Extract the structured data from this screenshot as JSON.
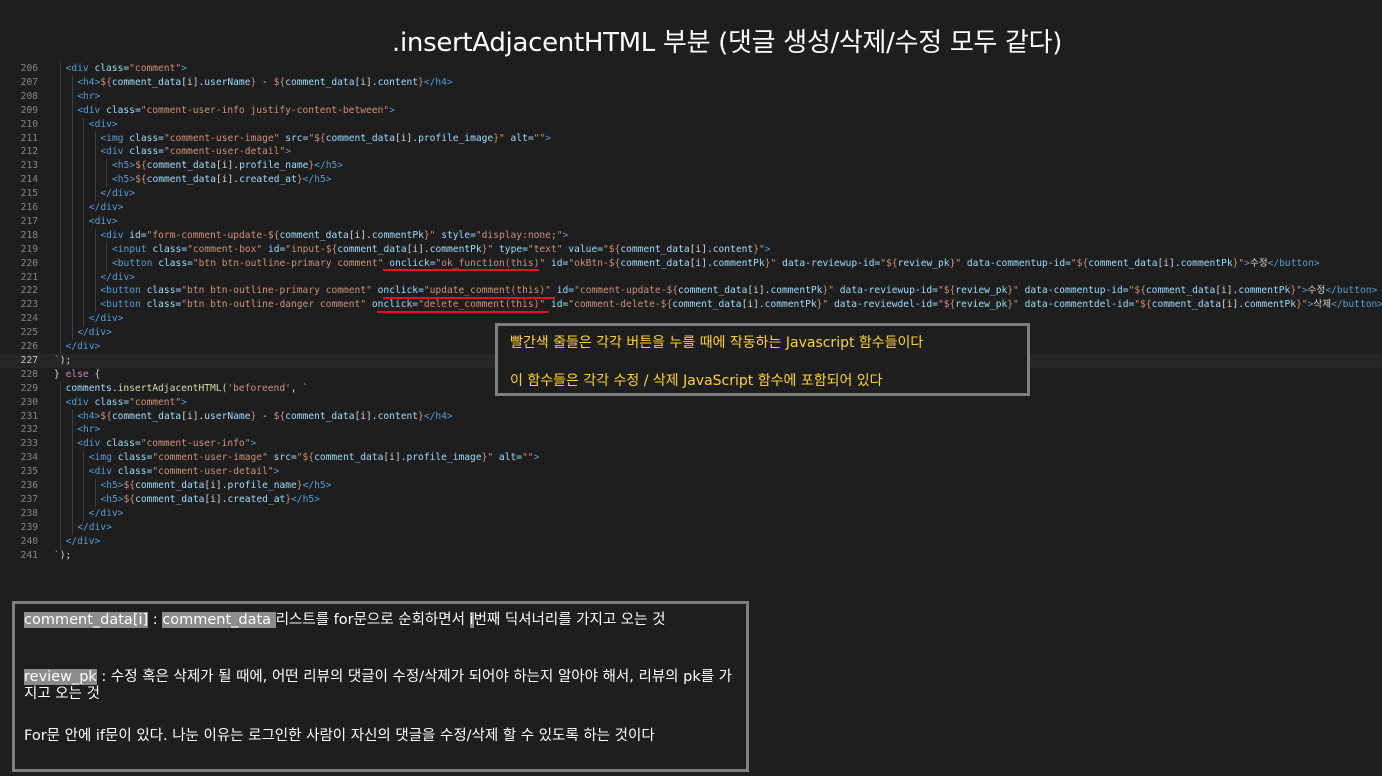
{
  "title": ".insertAdjacentHTML 부분 (댓글 생성/삭제/수정 모두 같다)",
  "code": {
    "lines": [
      {
        "n": "206",
        "indent": 1,
        "tokens": [
          [
            "tag",
            "<div "
          ],
          [
            "attr",
            "class="
          ],
          [
            "str",
            "\"comment\""
          ],
          [
            "tag",
            ">"
          ]
        ]
      },
      {
        "n": "207",
        "indent": 2,
        "tokens": [
          [
            "tag",
            "<h4>"
          ],
          [
            "str",
            "${"
          ],
          [
            "var",
            "comment_data"
          ],
          [
            "txt",
            "[i]."
          ],
          [
            "var",
            "userName"
          ],
          [
            "str",
            "}"
          ],
          [
            "txt",
            " - "
          ],
          [
            "str",
            "${"
          ],
          [
            "var",
            "comment_data"
          ],
          [
            "txt",
            "[i]."
          ],
          [
            "var",
            "content"
          ],
          [
            "str",
            "}"
          ],
          [
            "tag",
            "</h4>"
          ]
        ]
      },
      {
        "n": "208",
        "indent": 2,
        "tokens": [
          [
            "tag",
            "<hr>"
          ]
        ]
      },
      {
        "n": "209",
        "indent": 2,
        "tokens": [
          [
            "tag",
            "<div "
          ],
          [
            "attr",
            "class="
          ],
          [
            "str",
            "\"comment-user-info justify-content-between\""
          ],
          [
            "tag",
            ">"
          ]
        ]
      },
      {
        "n": "210",
        "indent": 3,
        "tokens": [
          [
            "tag",
            "<div>"
          ]
        ]
      },
      {
        "n": "211",
        "indent": 4,
        "tokens": [
          [
            "tag",
            "<img "
          ],
          [
            "attr",
            "class="
          ],
          [
            "str",
            "\"comment-user-image\" "
          ],
          [
            "attr",
            "src="
          ],
          [
            "str",
            "\"${"
          ],
          [
            "var",
            "comment_data"
          ],
          [
            "txt",
            "[i]."
          ],
          [
            "var",
            "profile_image"
          ],
          [
            "str",
            "}\" "
          ],
          [
            "attr",
            "alt="
          ],
          [
            "str",
            "\"\""
          ],
          [
            "tag",
            ">"
          ]
        ]
      },
      {
        "n": "212",
        "indent": 4,
        "tokens": [
          [
            "tag",
            "<div "
          ],
          [
            "attr",
            "class="
          ],
          [
            "str",
            "\"comment-user-detail\""
          ],
          [
            "tag",
            ">"
          ]
        ]
      },
      {
        "n": "213",
        "indent": 5,
        "tokens": [
          [
            "tag",
            "<h5>"
          ],
          [
            "str",
            "${"
          ],
          [
            "var",
            "comment_data"
          ],
          [
            "txt",
            "[i]."
          ],
          [
            "var",
            "profile_name"
          ],
          [
            "str",
            "}"
          ],
          [
            "tag",
            "</h5>"
          ]
        ]
      },
      {
        "n": "214",
        "indent": 5,
        "tokens": [
          [
            "tag",
            "<h5>"
          ],
          [
            "str",
            "${"
          ],
          [
            "var",
            "comment_data"
          ],
          [
            "txt",
            "[i]."
          ],
          [
            "var",
            "created_at"
          ],
          [
            "str",
            "}"
          ],
          [
            "tag",
            "</h5>"
          ]
        ]
      },
      {
        "n": "215",
        "indent": 4,
        "tokens": [
          [
            "tag",
            "</div>"
          ]
        ]
      },
      {
        "n": "216",
        "indent": 3,
        "tokens": [
          [
            "tag",
            "</div>"
          ]
        ]
      },
      {
        "n": "217",
        "indent": 3,
        "tokens": [
          [
            "tag",
            "<div>"
          ]
        ]
      },
      {
        "n": "218",
        "indent": 4,
        "tokens": [
          [
            "tag",
            "<div "
          ],
          [
            "attr",
            "id="
          ],
          [
            "str",
            "\"form-comment-update-${"
          ],
          [
            "var",
            "comment_data"
          ],
          [
            "txt",
            "[i]."
          ],
          [
            "var",
            "commentPk"
          ],
          [
            "str",
            "}\" "
          ],
          [
            "attr",
            "style="
          ],
          [
            "str",
            "\"display:none;\""
          ],
          [
            "tag",
            ">"
          ]
        ]
      },
      {
        "n": "219",
        "indent": 5,
        "tokens": [
          [
            "tag",
            "<input "
          ],
          [
            "attr",
            "class="
          ],
          [
            "str",
            "\"comment-box\" "
          ],
          [
            "attr",
            "id="
          ],
          [
            "str",
            "\"input-${"
          ],
          [
            "var",
            "comment_data"
          ],
          [
            "txt",
            "[i]."
          ],
          [
            "var",
            "commentPk"
          ],
          [
            "str",
            "}\" "
          ],
          [
            "attr",
            "type="
          ],
          [
            "str",
            "\"text\" "
          ],
          [
            "attr",
            "value="
          ],
          [
            "str",
            "\"${"
          ],
          [
            "var",
            "comment_data"
          ],
          [
            "txt",
            "[i]."
          ],
          [
            "var",
            "content"
          ],
          [
            "str",
            "}\""
          ],
          [
            "tag",
            ">"
          ]
        ]
      },
      {
        "n": "220",
        "indent": 5,
        "tokens": [
          [
            "tag",
            "<button "
          ],
          [
            "attr",
            "class="
          ],
          [
            "str",
            "\"btn btn-outline-primary comment\" "
          ],
          [
            "attr",
            "onclick="
          ],
          [
            "str",
            "\"ok_function(this)\" "
          ],
          [
            "attr",
            "id="
          ],
          [
            "str",
            "\"okBtn-${"
          ],
          [
            "var",
            "comment_data"
          ],
          [
            "txt",
            "[i]."
          ],
          [
            "var",
            "commentPk"
          ],
          [
            "str",
            "}\" "
          ],
          [
            "attr",
            "data-reviewup-id="
          ],
          [
            "str",
            "\"${"
          ],
          [
            "var",
            "review_pk"
          ],
          [
            "str",
            "}\" "
          ],
          [
            "attr",
            "data-commentup-id="
          ],
          [
            "str",
            "\"${"
          ],
          [
            "var",
            "comment_data"
          ],
          [
            "txt",
            "[i]."
          ],
          [
            "var",
            "commentPk"
          ],
          [
            "str",
            "}\""
          ],
          [
            "tag",
            ">"
          ],
          [
            "txt",
            "수정"
          ],
          [
            "tag",
            "</button>"
          ]
        ]
      },
      {
        "n": "221",
        "indent": 4,
        "tokens": [
          [
            "tag",
            "</div>"
          ]
        ]
      },
      {
        "n": "222",
        "indent": 4,
        "tokens": [
          [
            "tag",
            "<button "
          ],
          [
            "attr",
            "class="
          ],
          [
            "str",
            "\"btn btn-outline-primary comment\" "
          ],
          [
            "attr",
            "onclick="
          ],
          [
            "str",
            "\"update_comment(this)\" "
          ],
          [
            "attr",
            "id="
          ],
          [
            "str",
            "\"comment-update-${"
          ],
          [
            "var",
            "comment_data"
          ],
          [
            "txt",
            "[i]."
          ],
          [
            "var",
            "commentPk"
          ],
          [
            "str",
            "}\" "
          ],
          [
            "attr",
            "data-reviewup-id="
          ],
          [
            "str",
            "\"${"
          ],
          [
            "var",
            "review_pk"
          ],
          [
            "str",
            "}\" "
          ],
          [
            "attr",
            "data-commentup-id="
          ],
          [
            "str",
            "\"${"
          ],
          [
            "var",
            "comment_data"
          ],
          [
            "txt",
            "[i]."
          ],
          [
            "var",
            "commentPk"
          ],
          [
            "str",
            "}\""
          ],
          [
            "tag",
            ">"
          ],
          [
            "txt",
            "수정"
          ],
          [
            "tag",
            "</button>"
          ]
        ]
      },
      {
        "n": "223",
        "indent": 4,
        "tokens": [
          [
            "tag",
            "<button "
          ],
          [
            "attr",
            "class="
          ],
          [
            "str",
            "\"btn btn-outline-danger comment\" "
          ],
          [
            "attr",
            "onclick="
          ],
          [
            "str",
            "\"delete_comment(this)\" "
          ],
          [
            "attr",
            "id="
          ],
          [
            "str",
            "\"comment-delete-${"
          ],
          [
            "var",
            "comment_data"
          ],
          [
            "txt",
            "[i]."
          ],
          [
            "var",
            "commentPk"
          ],
          [
            "str",
            "}\" "
          ],
          [
            "attr",
            "data-reviewdel-id="
          ],
          [
            "str",
            "\"${"
          ],
          [
            "var",
            "review_pk"
          ],
          [
            "str",
            "}\" "
          ],
          [
            "attr",
            "data-commentdel-id="
          ],
          [
            "str",
            "\"${"
          ],
          [
            "var",
            "comment_data"
          ],
          [
            "txt",
            "[i]."
          ],
          [
            "var",
            "commentPk"
          ],
          [
            "str",
            "}\""
          ],
          [
            "tag",
            ">"
          ],
          [
            "txt",
            "삭제"
          ],
          [
            "tag",
            "</button>"
          ]
        ]
      },
      {
        "n": "224",
        "indent": 3,
        "tokens": [
          [
            "tag",
            "</div>"
          ]
        ]
      },
      {
        "n": "225",
        "indent": 2,
        "tokens": [
          [
            "tag",
            "</div>"
          ]
        ]
      },
      {
        "n": "226",
        "indent": 1,
        "tokens": [
          [
            "tag",
            "</div>"
          ]
        ]
      },
      {
        "n": "227",
        "indent": 0,
        "current": true,
        "tokens": [
          [
            "str",
            "`"
          ],
          [
            "txt",
            ");"
          ]
        ]
      },
      {
        "n": "228",
        "indent": 0,
        "tokens": [
          [
            "txt",
            "} "
          ],
          [
            "kw",
            "else"
          ],
          [
            "txt",
            " {"
          ]
        ]
      },
      {
        "n": "229",
        "indent": 1,
        "tokens": [
          [
            "var",
            "comments"
          ],
          [
            "txt",
            "."
          ],
          [
            "fn",
            "insertAdjacentHTML"
          ],
          [
            "txt",
            "("
          ],
          [
            "str",
            "'beforeend'"
          ],
          [
            "txt",
            ", "
          ],
          [
            "str",
            "`"
          ]
        ]
      },
      {
        "n": "230",
        "indent": 1,
        "tokens": [
          [
            "tag",
            "<div "
          ],
          [
            "attr",
            "class="
          ],
          [
            "str",
            "\"comment\""
          ],
          [
            "tag",
            ">"
          ]
        ]
      },
      {
        "n": "231",
        "indent": 2,
        "tokens": [
          [
            "tag",
            "<h4>"
          ],
          [
            "str",
            "${"
          ],
          [
            "var",
            "comment_data"
          ],
          [
            "txt",
            "[i]."
          ],
          [
            "var",
            "userName"
          ],
          [
            "str",
            "}"
          ],
          [
            "txt",
            " - "
          ],
          [
            "str",
            "${"
          ],
          [
            "var",
            "comment_data"
          ],
          [
            "txt",
            "[i]."
          ],
          [
            "var",
            "content"
          ],
          [
            "str",
            "}"
          ],
          [
            "tag",
            "</h4>"
          ]
        ]
      },
      {
        "n": "232",
        "indent": 2,
        "tokens": [
          [
            "tag",
            "<hr>"
          ]
        ]
      },
      {
        "n": "233",
        "indent": 2,
        "tokens": [
          [
            "tag",
            "<div "
          ],
          [
            "attr",
            "class="
          ],
          [
            "str",
            "\"comment-user-info\""
          ],
          [
            "tag",
            ">"
          ]
        ]
      },
      {
        "n": "234",
        "indent": 3,
        "tokens": [
          [
            "tag",
            "<img "
          ],
          [
            "attr",
            "class="
          ],
          [
            "str",
            "\"comment-user-image\" "
          ],
          [
            "attr",
            "src="
          ],
          [
            "str",
            "\"${"
          ],
          [
            "var",
            "comment_data"
          ],
          [
            "txt",
            "[i]."
          ],
          [
            "var",
            "profile_image"
          ],
          [
            "str",
            "}\" "
          ],
          [
            "attr",
            "alt="
          ],
          [
            "str",
            "\"\""
          ],
          [
            "tag",
            ">"
          ]
        ]
      },
      {
        "n": "235",
        "indent": 3,
        "tokens": [
          [
            "tag",
            "<div "
          ],
          [
            "attr",
            "class="
          ],
          [
            "str",
            "\"comment-user-detail\""
          ],
          [
            "tag",
            ">"
          ]
        ]
      },
      {
        "n": "236",
        "indent": 4,
        "tokens": [
          [
            "tag",
            "<h5>"
          ],
          [
            "str",
            "${"
          ],
          [
            "var",
            "comment_data"
          ],
          [
            "txt",
            "[i]."
          ],
          [
            "var",
            "profile_name"
          ],
          [
            "str",
            "}"
          ],
          [
            "tag",
            "</h5>"
          ]
        ]
      },
      {
        "n": "237",
        "indent": 4,
        "tokens": [
          [
            "tag",
            "<h5>"
          ],
          [
            "str",
            "${"
          ],
          [
            "var",
            "comment_data"
          ],
          [
            "txt",
            "[i]."
          ],
          [
            "var",
            "created_at"
          ],
          [
            "str",
            "}"
          ],
          [
            "tag",
            "</h5>"
          ]
        ]
      },
      {
        "n": "238",
        "indent": 3,
        "tokens": [
          [
            "tag",
            "</div>"
          ]
        ]
      },
      {
        "n": "239",
        "indent": 2,
        "tokens": [
          [
            "tag",
            "</div>"
          ]
        ]
      },
      {
        "n": "240",
        "indent": 1,
        "tokens": [
          [
            "tag",
            "</div>"
          ]
        ]
      },
      {
        "n": "241",
        "indent": 0,
        "tokens": [
          [
            "str",
            "`"
          ],
          [
            "txt",
            ");"
          ]
        ]
      }
    ]
  },
  "note_top": {
    "line1": "빨간색 줄들은 각각 버튼을 누를 때에 작동하는 Javascript 함수들이다",
    "line2": "이 함수들은 각각 수정 / 삭제 JavaScript 함수에 포함되어 있다"
  },
  "note_bottom": {
    "p1_hl1": "comment_data[i]",
    "p1_sep": " : ",
    "p1_hl2": "comment_data ",
    "p1_rest_a": "리스트를 for문으로 순회하면서 ",
    "p1_hl3": "i",
    "p1_rest_b": "번째 딕셔너리를 가지고 오는 것",
    "p2_hl": "review_pk",
    "p2_rest": " :  수정 혹은 삭제가 될 때에, 어떤 리뷰의 댓글이 수정/삭제가 되어야 하는지 알아야 해서, 리뷰의 pk를 가지고 오는 것",
    "p3": "For문 안에 if문이 있다. 나눈 이유는 로그인한 사람이 자신의 댓글을 수정/삭제 할 수 있도록 하는 것이다"
  },
  "colors": {
    "background": "#1e1e1e",
    "tag": "#569cd6",
    "attr": "#9cdcfe",
    "string": "#ce9178",
    "underline": "#e81123",
    "note_yellow": "#ffd32a"
  }
}
